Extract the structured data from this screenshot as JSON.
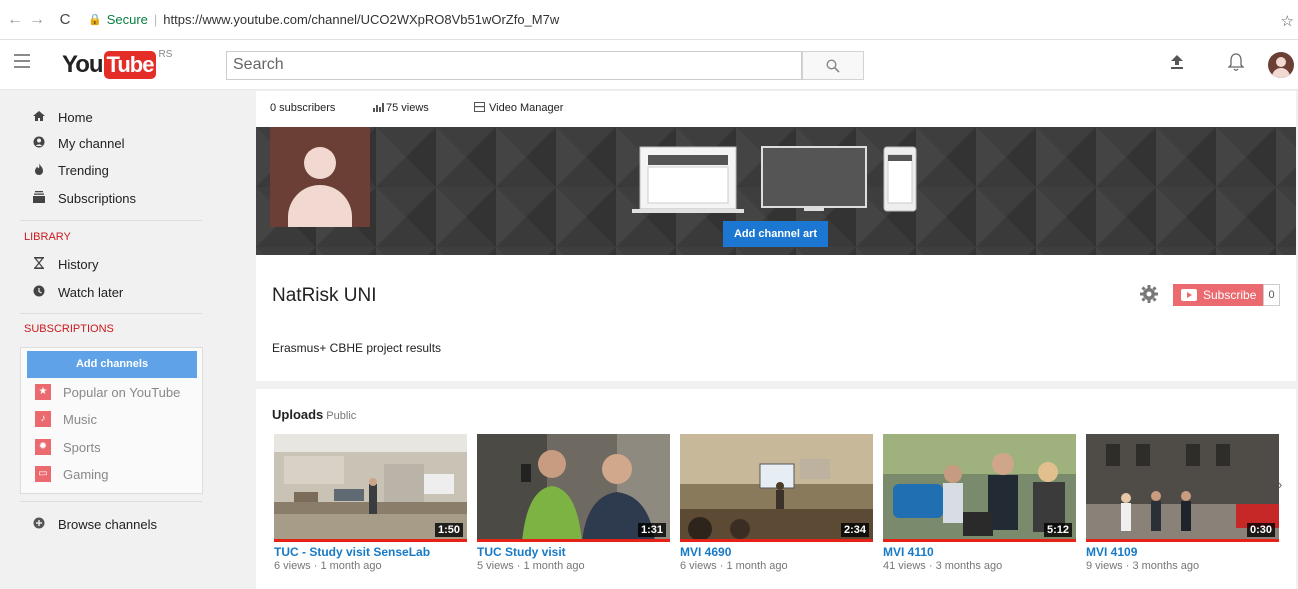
{
  "browser": {
    "secure_label": "Secure",
    "url": "https://www.youtube.com/channel/UCO2WXpRO8Vb51wOrZfo_M7w"
  },
  "masthead": {
    "logo_you": "You",
    "logo_tube": "Tube",
    "country": "RS",
    "search_placeholder": "Search"
  },
  "sidebar": {
    "nav": [
      {
        "label": "Home",
        "icon": "home-icon"
      },
      {
        "label": "My channel",
        "icon": "person-icon"
      },
      {
        "label": "Trending",
        "icon": "flame-icon"
      },
      {
        "label": "Subscriptions",
        "icon": "subscriptions-icon"
      }
    ],
    "library_heading": "LIBRARY",
    "library": [
      {
        "label": "History",
        "icon": "hourglass-icon"
      },
      {
        "label": "Watch later",
        "icon": "clock-icon"
      }
    ],
    "subscriptions_heading": "SUBSCRIPTIONS",
    "add_channels": "Add channels",
    "subscriptions": [
      {
        "label": "Popular on YouTube",
        "icon": "star-icon"
      },
      {
        "label": "Music",
        "icon": "music-note-icon"
      },
      {
        "label": "Sports",
        "icon": "ball-icon"
      },
      {
        "label": "Gaming",
        "icon": "gamepad-icon"
      }
    ],
    "browse_channels": "Browse channels"
  },
  "channel": {
    "subscribers": "0 subscribers",
    "views": "75 views",
    "video_manager": "Video Manager",
    "add_channel_art": "Add channel art",
    "name": "NatRisk UNI",
    "subscribe_label": "Subscribe",
    "subscribe_count": "0",
    "description": "Erasmus+ CBHE project results"
  },
  "uploads": {
    "title": "Uploads",
    "visibility": "Public",
    "videos": [
      {
        "title": "TUC - Study visit SenseLab",
        "meta": "6 views · 1 month ago",
        "duration": "1:50"
      },
      {
        "title": "TUC Study visit",
        "meta": "5 views · 1 month ago",
        "duration": "1:31"
      },
      {
        "title": "MVI 4690",
        "meta": "6 views · 1 month ago",
        "duration": "2:34"
      },
      {
        "title": "MVI 4110",
        "meta": "41 views · 3 months ago",
        "duration": "5:12"
      },
      {
        "title": "MVI 4109",
        "meta": "9 views · 3 months ago",
        "duration": "0:30"
      }
    ]
  },
  "colors": {
    "brand_red": "#e52d27",
    "link_blue": "#167ac6",
    "button_blue": "#1b77d2",
    "subscribe_red": "#ea6a6f"
  }
}
